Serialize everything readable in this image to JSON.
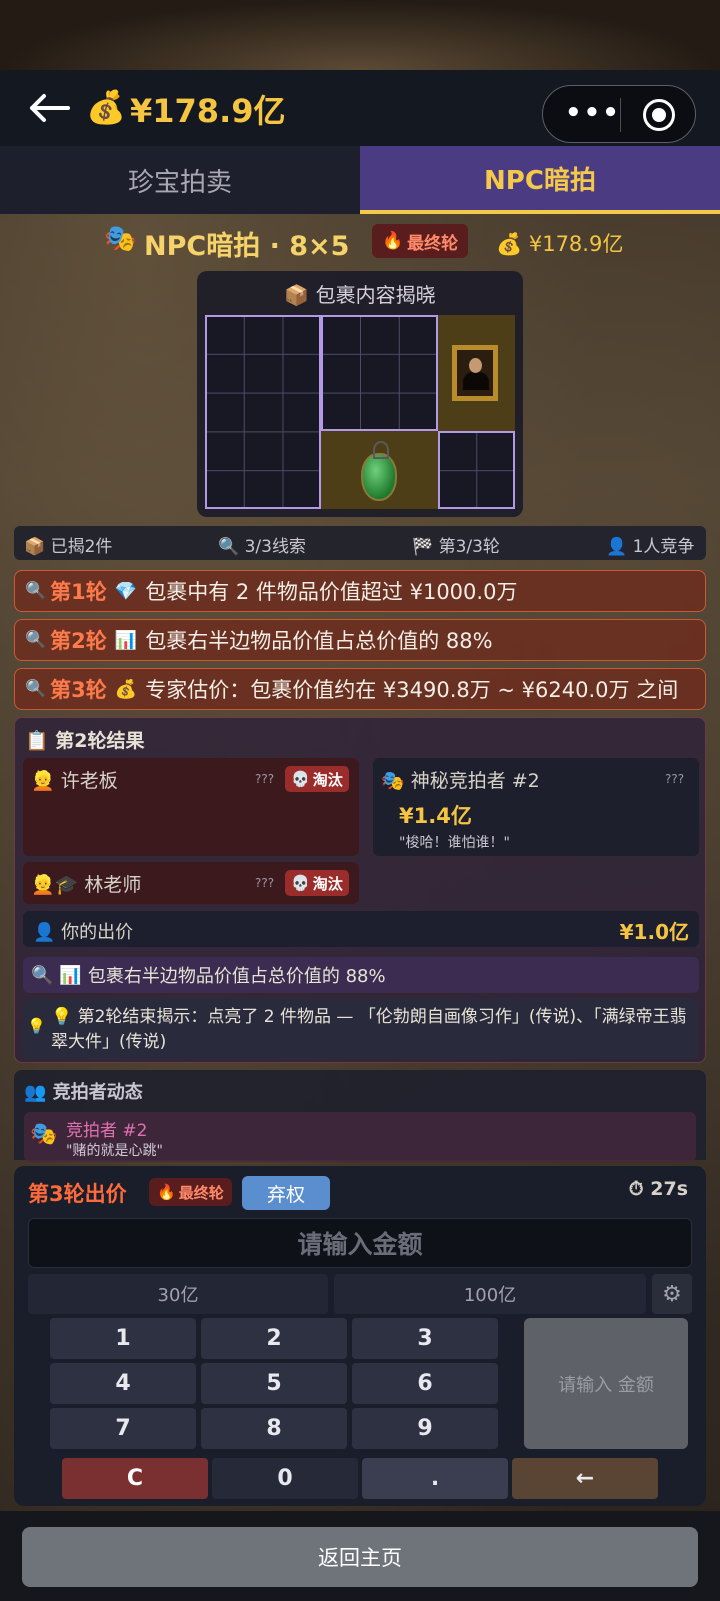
{
  "header": {
    "balance": "¥178.9亿",
    "icons": [
      "back-arrow-icon",
      "money-bag-icon",
      "more-dots-icon",
      "target-icon"
    ]
  },
  "tabs": [
    {
      "label": "珍宝拍卖",
      "active": false
    },
    {
      "label": "NPC暗拍",
      "active": true
    }
  ],
  "auction": {
    "title": "NPC暗拍 · 8×5",
    "final_badge": "最终轮",
    "balance": "¥178.9亿",
    "grid_title": "包裹内容揭晓"
  },
  "stats": {
    "revealed": "已揭2件",
    "clues": "3/3线索",
    "round": "第3/3轮",
    "competitors": "1人竞争"
  },
  "clues": [
    {
      "round": "第1轮",
      "icon": "diamond-icon",
      "text": "包裹中有 2 件物品价值超过 ¥1000.0万"
    },
    {
      "round": "第2轮",
      "icon": "chart-icon",
      "text": "包裹右半边物品价值占总价值的 88%"
    },
    {
      "round": "第3轮",
      "icon": "money-bag-icon",
      "text": "专家估价：包裹价值约在 ¥3490.8万 ~ ¥6240.0万 之间"
    }
  ],
  "results": {
    "title": "第2轮结果",
    "bidders": [
      {
        "name": "许老板",
        "hidden": "???",
        "status": "淘汰"
      },
      {
        "name": "神秘竞拍者 #2",
        "hidden": "???",
        "bid": "¥1.4亿",
        "quote": "\"梭哈！谁怕谁！\""
      },
      {
        "name": "林老师",
        "hidden": "???",
        "status": "淘汰"
      }
    ],
    "my_bid_label": "你的出价",
    "my_bid": "¥1.0亿",
    "hint_clue": "包裹右半边物品价值占总价值的 88%",
    "reveal_text": "第2轮结束揭示：点亮了 2 件物品 — 「伦勃朗自画像习作」(传说)、「满绿帝王翡翠大件」(传说)"
  },
  "activity": {
    "title": "竞拍者动态",
    "items": [
      {
        "who": "竞拍者 #2",
        "says": "\"赌的就是心跳\""
      }
    ]
  },
  "bid_panel": {
    "title": "第3轮出价",
    "final_badge": "最终轮",
    "forfeit": "弃权",
    "timer": "27s",
    "placeholder": "请输入金额",
    "presets": [
      "30亿",
      "100亿"
    ],
    "keys": [
      "1",
      "2",
      "3",
      "4",
      "5",
      "6",
      "7",
      "8",
      "9",
      "C",
      "0",
      ".",
      "←"
    ],
    "confirm": "请输入 金额"
  },
  "footer": {
    "home": "返回主页"
  },
  "colors": {
    "gold": "#f5c542",
    "active_tab": "#4b3b82",
    "clue_bg": "#6e2c1e",
    "eliminated": "#9b2c2c"
  }
}
